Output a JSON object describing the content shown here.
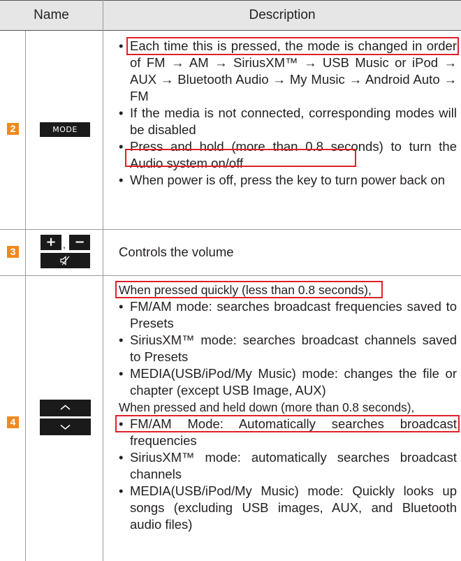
{
  "header": {
    "name": "Name",
    "description": "Description"
  },
  "rows": [
    {
      "number": "2",
      "key_label": "MODE",
      "bullets": [
        "Each time this is pressed, the mode is changed in order of FM → AM → SiriusXM™ → USB Music or iPod → AUX → Bluetooth Audio → My Music → Android Auto → FM",
        "If the media is not connected, corresponding modes will be disabled",
        "Press and hold (more than 0.8 seconds) to turn the Audio system on/off",
        "When power is off, press the key to turn power back on"
      ]
    },
    {
      "number": "3",
      "key_plus": "+",
      "key_comma": ",",
      "key_minus": "−",
      "key_mute_icon": "mute-icon",
      "text": "Controls the volume"
    },
    {
      "number": "4",
      "key_up_icon": "chevron-up-icon",
      "key_down_icon": "chevron-down-icon",
      "quick_heading": "When pressed quickly (less than 0.8 seconds),",
      "quick_bullets": [
        "FM/AM mode: searches broadcast frequencies saved to Presets",
        "SiriusXM™ mode: searches broadcast channels saved to Presets",
        "MEDIA(USB/iPod/My Music) mode: changes the file or chapter (except USB Image, AUX)"
      ],
      "hold_heading": "When pressed and held down (more than 0.8 seconds),",
      "hold_bullets": [
        "FM/AM Mode: Automatically searches broadcast frequencies",
        "SiriusXM™ mode: automatically searches broadcast channels",
        "MEDIA(USB/iPod/My Music) mode: Quickly looks up songs (excluding USB images, AUX, and Bluetooth audio files)"
      ]
    }
  ],
  "colors": {
    "highlight": "#e0202a",
    "number_badge": "#f08a1c",
    "header_bg": "#e6e6e6",
    "key_bg": "#1a1a1a"
  }
}
